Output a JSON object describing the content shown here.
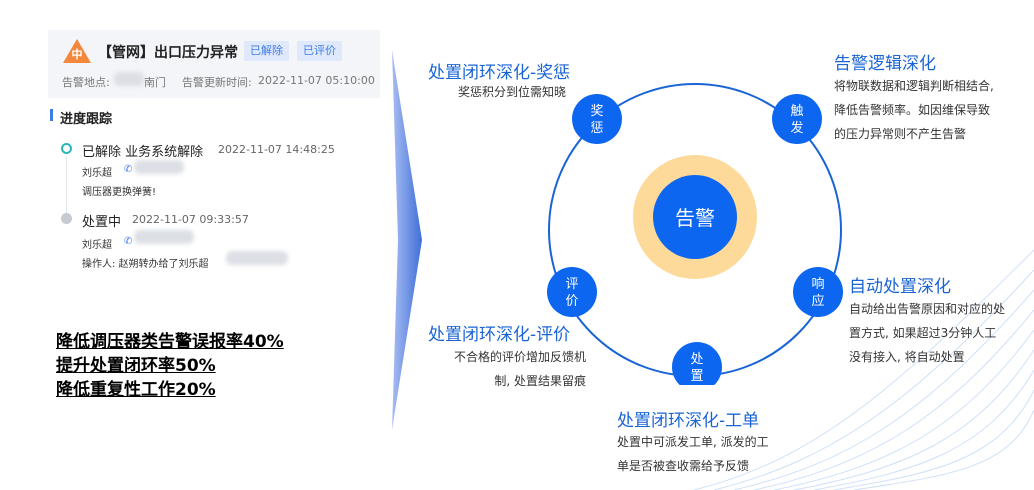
{
  "alarm_card": {
    "badge": "中",
    "title": "【管网】出口压力异常",
    "tags": [
      "已解除",
      "已评价"
    ],
    "location_label": "告警地点:",
    "location_value": "南门",
    "update_label": "告警更新时间:",
    "update_time": "2022-11-07 05:10:00"
  },
  "progress": {
    "title": "进度跟踪",
    "entries": [
      {
        "status": "已解除 业务系统解除",
        "time": "2022-11-07 14:48:25",
        "person": "刘乐超",
        "note": "调压器更换弹簧!"
      },
      {
        "status": "处置中",
        "time": "2022-11-07 09:33:57",
        "person": "刘乐超",
        "note": "操作人: 赵朔转办给了刘乐超"
      }
    ]
  },
  "kpis": [
    "降低调压器类告警误报率40%",
    "提升处置闭环率50%",
    "降低重复性工作20%"
  ],
  "diagram": {
    "center": "告警",
    "nodes": {
      "jiangcheng": "奖惩",
      "chufa": "触发",
      "xiangying": "响应",
      "chuzhi": "处置",
      "pingjia": "评价"
    },
    "blocks": {
      "jiangcheng": {
        "title": "处置闭环深化-奖惩",
        "desc": [
          "奖惩积分到位需知晓"
        ]
      },
      "chufa": {
        "title": "告警逻辑深化",
        "desc": [
          "将物联数据和逻辑判断相结合,",
          "降低告警频率。如因维保导致",
          "的压力异常则不产生告警"
        ]
      },
      "xiangying": {
        "title": "自动处置深化",
        "desc": [
          "自动给出告警原因和对应的处",
          "置方式, 如果超过3分钟人工",
          "没有接入, 将自动处置"
        ]
      },
      "pingjia": {
        "title": "处置闭环深化-评价",
        "desc": [
          "不合格的评价增加反馈机",
          "制, 处置结果留痕"
        ]
      },
      "chuzhi": {
        "title": "处置闭环深化-工单",
        "desc": [
          "处置中可派发工单, 派发的工",
          "单是否被查收需给予反馈"
        ]
      }
    }
  },
  "colors": {
    "primary_blue": "#1a64d6",
    "node_blue": "#0d66f0",
    "center_ring": "#fdd99a",
    "arrow_blue": "#7f9ee8"
  }
}
